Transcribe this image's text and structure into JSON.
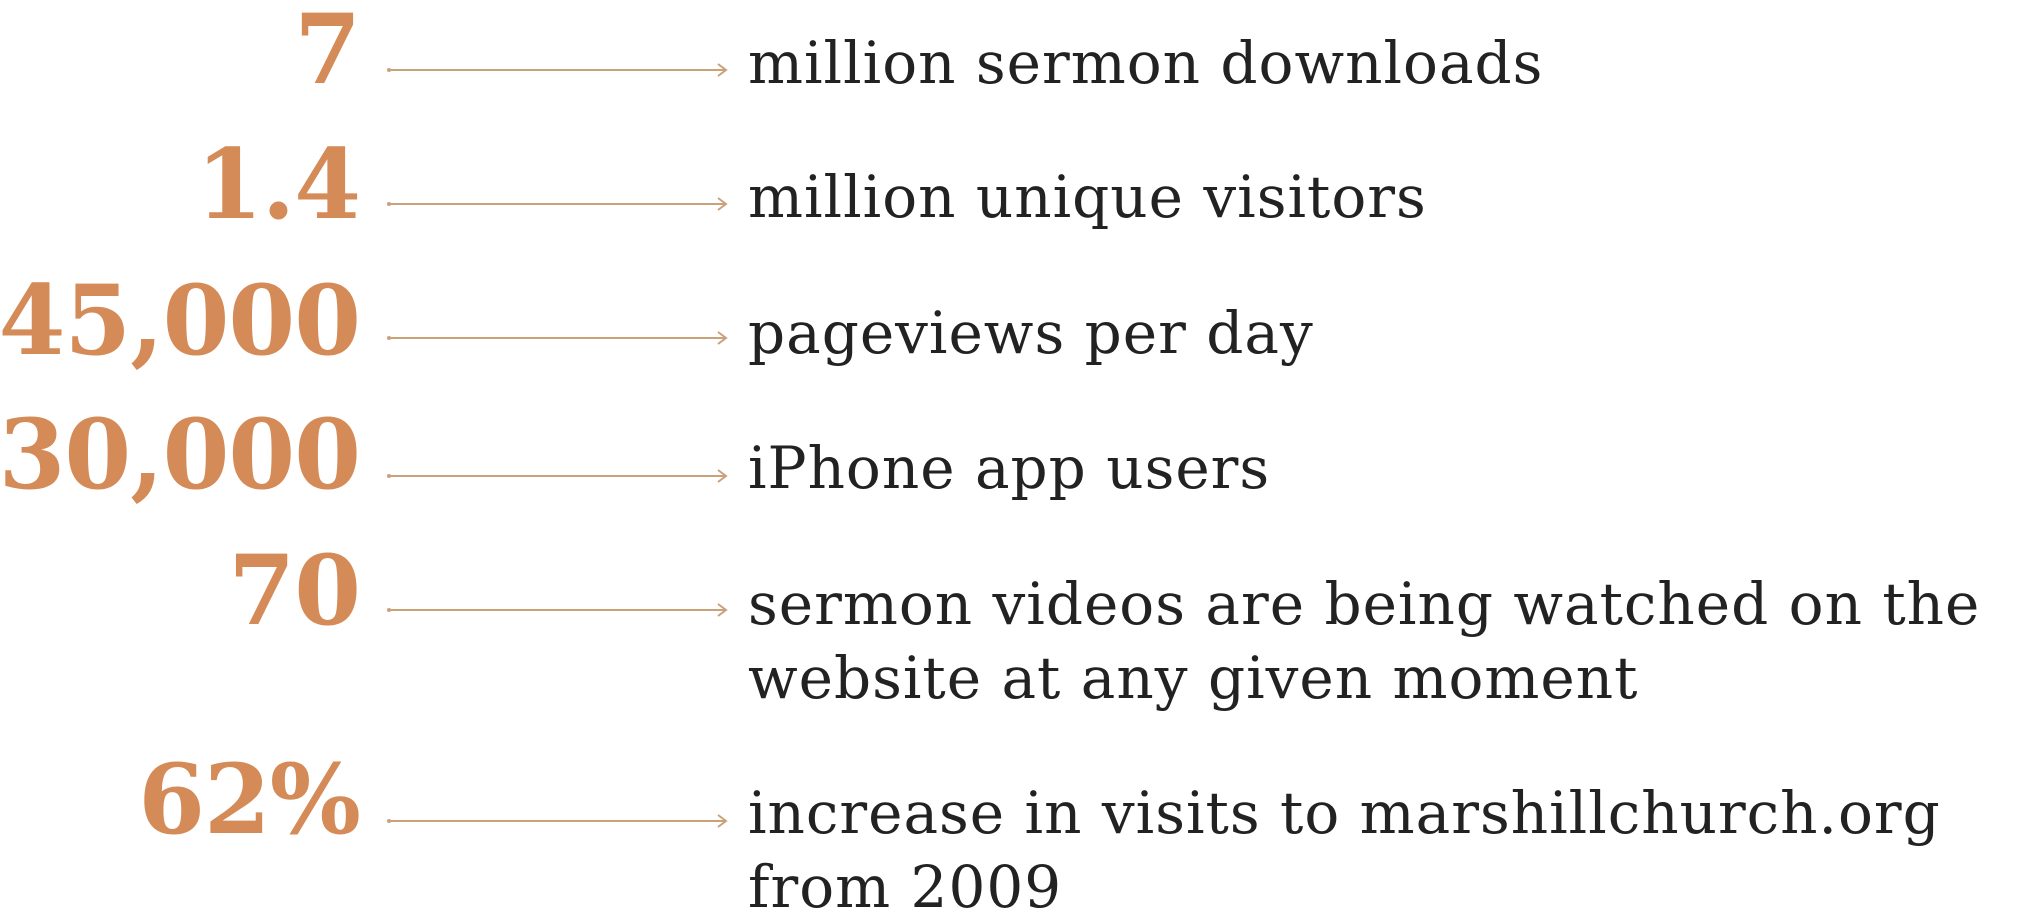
{
  "stats": [
    {
      "number": "7",
      "label_lines": [
        "million sermon downloads"
      ]
    },
    {
      "number": "1.4",
      "label_lines": [
        "million unique visitors"
      ]
    },
    {
      "number": "45,000",
      "label_lines": [
        "pageviews per day"
      ]
    },
    {
      "number": "30,000",
      "label_lines": [
        "iPhone app users"
      ]
    },
    {
      "number": "70",
      "label_lines": [
        "sermon videos are being watched on the",
        "website at any given moment"
      ]
    },
    {
      "number": "62%",
      "label_lines": [
        "increase in visits to marshillchurch.org",
        "from 2009"
      ]
    }
  ],
  "colors": {
    "number": "#d48b57",
    "arrow": "#c9a27a",
    "text": "#222222",
    "background": "#ffffff"
  }
}
